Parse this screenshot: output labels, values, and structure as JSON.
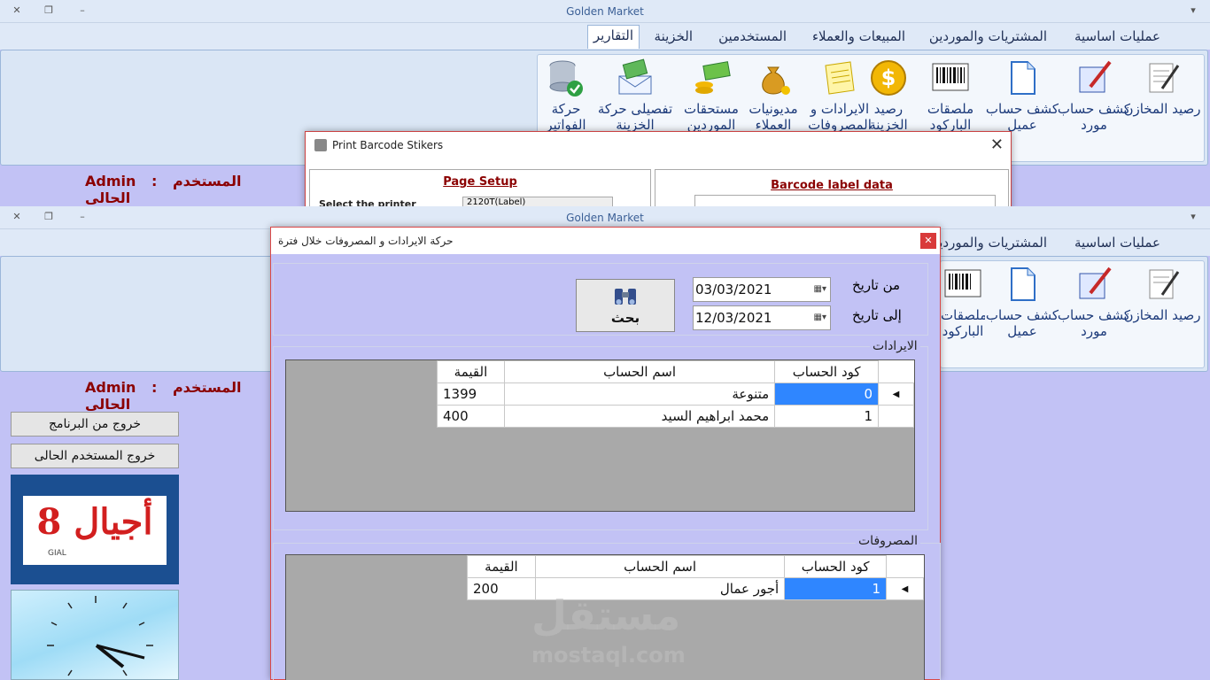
{
  "app": {
    "title": "Golden Market",
    "window_controls": [
      "✕",
      "❐",
      "–"
    ]
  },
  "tabs": [
    "عمليات اساسية",
    "المشتريات والموردين",
    "المبيعات والعملاء",
    "المستخدمين",
    "الخزينة",
    "التقارير"
  ],
  "ribbon_top": [
    {
      "label": "رصيد المخازن",
      "icon": "document-pen-icon"
    },
    {
      "label": "كشف حساب مورد",
      "icon": "clipboard-pen-icon"
    },
    {
      "label": "كشف حساب عميل",
      "icon": "blank-page-icon"
    },
    {
      "label": "ملصقات الباركود",
      "icon": "barcode-icon"
    },
    {
      "label": "رصيد الخزينة",
      "icon": "dollar-coin-icon"
    },
    {
      "label": "الايرادات و المصروفات",
      "icon": "notes-icon"
    },
    {
      "label": "مديونيات العملاء",
      "icon": "money-bag-icon"
    },
    {
      "label": "مستحقات الموردين",
      "icon": "cash-coins-icon"
    },
    {
      "label": "تفصيلى حركة الخزينة",
      "icon": "money-envelope-icon"
    },
    {
      "label": "حركة الفواتير",
      "icon": "database-check-icon"
    }
  ],
  "ribbon_bottom": [
    {
      "label": "رصيد المخازن",
      "icon": "document-pen-icon"
    },
    {
      "label": "كشف حساب مورد",
      "icon": "clipboard-pen-icon"
    },
    {
      "label": "كشف حساب عميل",
      "icon": "blank-page-icon"
    },
    {
      "label": "ملصقات الباركود",
      "icon": "barcode-icon"
    }
  ],
  "user": {
    "label": "المستخدم الحالى",
    "sep": ":",
    "name": "Admin"
  },
  "sidebar": {
    "exit_program": "خروج من البرنامج",
    "logout_user": "خروج المستخدم الحالى",
    "logo_text": "أجيال 8",
    "logo_sub": "GIAL"
  },
  "barcode_dialog": {
    "title": "Print Barcode Stikers",
    "page_setup": "Page Setup",
    "label_data": "Barcode label data",
    "printer_label": "Select the printer",
    "printer_value": "2120T(Label)"
  },
  "report_dialog": {
    "title": "حركة الايرادات و المصروفات خلال فترة",
    "from_label": "من تاريخ",
    "to_label": "إلى تاريخ",
    "from_date": "03/03/2021",
    "to_date": "12/03/2021",
    "search_label": "بحث",
    "revenues_label": "الايرادات",
    "expenses_label": "المصروفات",
    "columns": [
      "كود الحساب",
      "اسم الحساب",
      "القيمة"
    ],
    "revenues": [
      {
        "code": "0",
        "name": "متنوعة",
        "value": "1399"
      },
      {
        "code": "1",
        "name": "محمد ابراهيم السيد",
        "value": "400"
      }
    ],
    "expenses": [
      {
        "code": "1",
        "name": "أجور عمال",
        "value": "200"
      }
    ]
  },
  "watermark": {
    "arabic": "مستقل",
    "latin": "mostaql.com"
  }
}
